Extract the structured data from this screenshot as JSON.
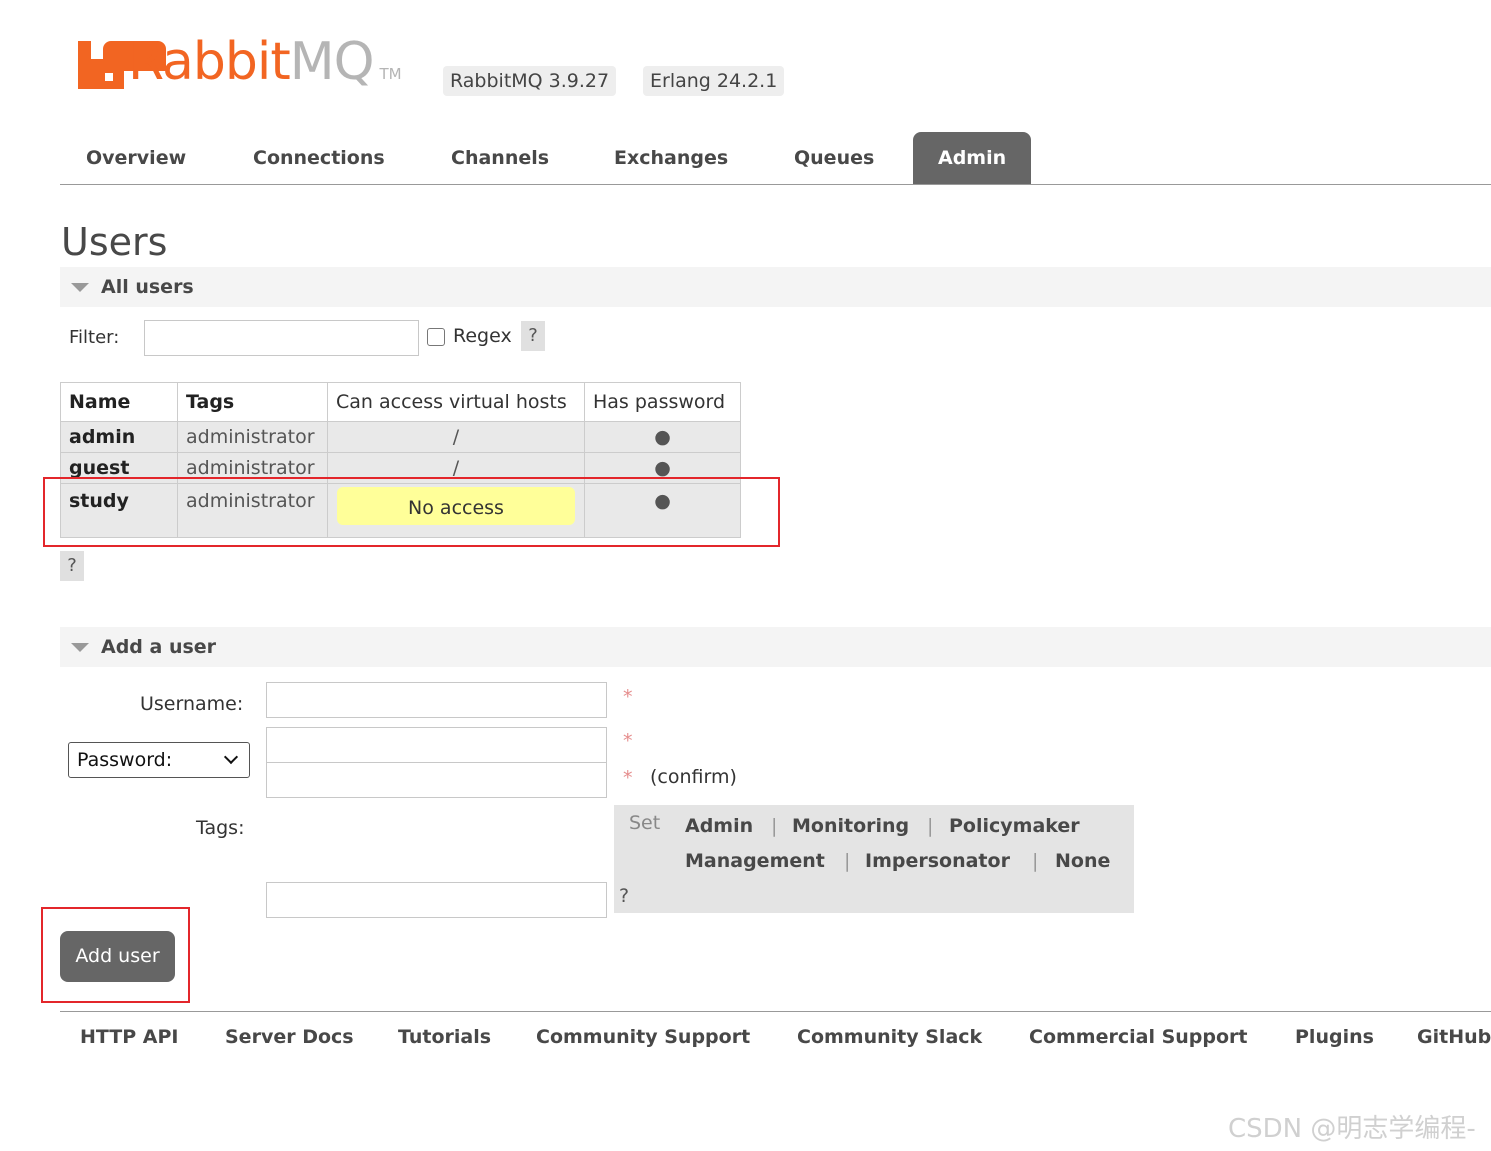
{
  "header": {
    "logo_rabbit": "Rabbit",
    "logo_mq": "MQ",
    "logo_tm": "TM",
    "rabbitmq_version": "RabbitMQ 3.9.27",
    "erlang_version": "Erlang 24.2.1"
  },
  "nav": {
    "tabs": [
      "Overview",
      "Connections",
      "Channels",
      "Exchanges",
      "Queues",
      "Admin"
    ],
    "active": "Admin"
  },
  "page_title": "Users",
  "all_users": {
    "section_title": "All users",
    "filter_label": "Filter:",
    "filter_value": "",
    "regex_label": "Regex",
    "regex_checked": false,
    "help": "?",
    "columns": [
      "Name",
      "Tags",
      "Can access virtual hosts",
      "Has password"
    ],
    "rows": [
      {
        "name": "admin",
        "tags": "administrator",
        "vhosts": "/",
        "has_password": "●"
      },
      {
        "name": "guest",
        "tags": "administrator",
        "vhosts": "/",
        "has_password": "●"
      },
      {
        "name": "study",
        "tags": "administrator",
        "vhosts": "No access",
        "has_password": "●"
      }
    ],
    "table_help": "?"
  },
  "add_user": {
    "section_title": "Add a user",
    "username_label": "Username:",
    "username_value": "",
    "password_select": "Password:",
    "password_options": [
      "Password:"
    ],
    "required_mark": "*",
    "confirm_label": "(confirm)",
    "tags_label": "Tags:",
    "tags_value": "",
    "set_label": "Set",
    "tag_options": [
      "Admin",
      "Monitoring",
      "Policymaker",
      "Management",
      "Impersonator",
      "None"
    ],
    "separator": "|",
    "tags_help": "?",
    "submit_label": "Add user"
  },
  "footer": {
    "links": [
      "HTTP API",
      "Server Docs",
      "Tutorials",
      "Community Support",
      "Community Slack",
      "Commercial Support",
      "Plugins",
      "GitHub"
    ]
  },
  "watermark": "CSDN @明志学编程-",
  "colors": {
    "brand_orange": "#f26522",
    "active_tab": "#666666",
    "no_access_highlight": "#ffff99",
    "annotation_red": "#e3262b"
  }
}
